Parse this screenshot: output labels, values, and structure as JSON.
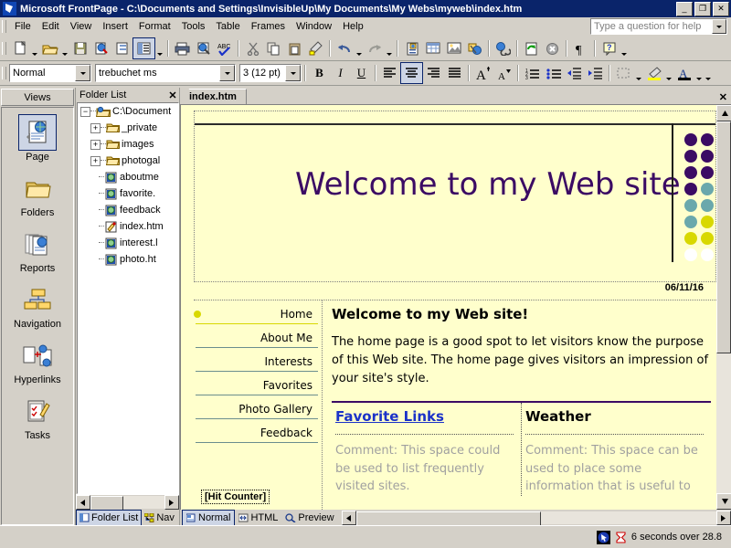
{
  "window": {
    "title": "Microsoft FrontPage - C:\\Documents and Settings\\InvisibleUp\\My Documents\\My Webs\\myweb\\index.htm",
    "minimize": "_",
    "restore": "❐",
    "close": "✕"
  },
  "menu": {
    "items": [
      "File",
      "Edit",
      "View",
      "Insert",
      "Format",
      "Tools",
      "Table",
      "Frames",
      "Window",
      "Help"
    ],
    "help_placeholder": "Type a question for help"
  },
  "standard_toolbar": {
    "buttons": [
      {
        "name": "new-page-icon",
        "title": "New"
      },
      {
        "name": "open-icon",
        "title": "Open"
      },
      {
        "name": "save-icon",
        "title": "Save"
      },
      {
        "name": "publish-web-icon",
        "title": "Publish Web"
      },
      {
        "name": "folder-list-toggle-icon",
        "title": "Toggle Folder List"
      },
      {
        "name": "navigation-pane-icon",
        "title": "Navigation Pane"
      },
      {
        "name": "print-icon",
        "title": "Print"
      },
      {
        "name": "preview-browser-icon",
        "title": "Preview in Browser"
      },
      {
        "name": "spelling-icon",
        "title": "Spelling"
      },
      {
        "name": "cut-icon",
        "title": "Cut"
      },
      {
        "name": "copy-icon",
        "title": "Copy"
      },
      {
        "name": "paste-icon",
        "title": "Paste"
      },
      {
        "name": "format-painter-icon",
        "title": "Format Painter"
      },
      {
        "name": "undo-icon",
        "title": "Undo"
      },
      {
        "name": "redo-icon",
        "title": "Redo"
      },
      {
        "name": "insert-component-icon",
        "title": "Insert Component"
      },
      {
        "name": "insert-table-icon",
        "title": "Insert Table"
      },
      {
        "name": "insert-picture-icon",
        "title": "Insert Picture"
      },
      {
        "name": "drawing-icon",
        "title": "Drawing"
      },
      {
        "name": "hyperlink-icon",
        "title": "Hyperlink"
      },
      {
        "name": "refresh-icon",
        "title": "Refresh"
      },
      {
        "name": "stop-icon",
        "title": "Stop"
      },
      {
        "name": "show-all-icon",
        "title": "Show All"
      },
      {
        "name": "help-icon",
        "title": "Microsoft FrontPage Help"
      }
    ]
  },
  "format_toolbar": {
    "style": "Normal",
    "font": "trebuchet ms",
    "size": "3  (12 pt)",
    "bold": "B",
    "italic": "I",
    "underline": "U",
    "buttons": [
      {
        "name": "align-left-icon"
      },
      {
        "name": "align-center-icon"
      },
      {
        "name": "align-right-icon"
      },
      {
        "name": "justify-icon"
      },
      {
        "name": "increase-font-size-icon"
      },
      {
        "name": "decrease-font-size-icon"
      },
      {
        "name": "numbered-list-icon"
      },
      {
        "name": "bulleted-list-icon"
      },
      {
        "name": "decrease-indent-icon"
      },
      {
        "name": "increase-indent-icon"
      },
      {
        "name": "borders-icon"
      },
      {
        "name": "highlight-color-icon"
      },
      {
        "name": "font-color-icon"
      }
    ]
  },
  "views": {
    "header": "Views",
    "items": [
      {
        "label": "Page",
        "icon": "page-view-icon",
        "selected": true
      },
      {
        "label": "Folders",
        "icon": "folders-view-icon",
        "selected": false
      },
      {
        "label": "Reports",
        "icon": "reports-view-icon",
        "selected": false
      },
      {
        "label": "Navigation",
        "icon": "navigation-view-icon",
        "selected": false
      },
      {
        "label": "Hyperlinks",
        "icon": "hyperlinks-view-icon",
        "selected": false
      },
      {
        "label": "Tasks",
        "icon": "tasks-view-icon",
        "selected": false
      }
    ]
  },
  "folder_list": {
    "header": "Folder List",
    "close": "✕",
    "root": "C:\\Document",
    "nodes": [
      {
        "label": "_private",
        "type": "folder",
        "expander": "+"
      },
      {
        "label": "images",
        "type": "folder",
        "expander": "+"
      },
      {
        "label": "photogal",
        "type": "folder",
        "expander": "+"
      },
      {
        "label": "aboutme",
        "type": "page"
      },
      {
        "label": "favorite.",
        "type": "page"
      },
      {
        "label": "feedback",
        "type": "page"
      },
      {
        "label": "index.htm",
        "type": "page-open"
      },
      {
        "label": "interest.l",
        "type": "page"
      },
      {
        "label": "photo.ht",
        "type": "page"
      }
    ],
    "tabs": [
      {
        "label": "Folder List",
        "icon": "folder-list-icon",
        "selected": true
      },
      {
        "label": "Nav",
        "icon": "navigation-icon",
        "selected": false
      }
    ]
  },
  "document": {
    "tab": "index.htm",
    "close": "✕",
    "view_tabs": [
      {
        "label": "Normal",
        "icon": "normal-view-icon",
        "selected": true
      },
      {
        "label": "HTML",
        "icon": "html-view-icon",
        "selected": false
      },
      {
        "label": "Preview",
        "icon": "preview-view-icon",
        "selected": false
      }
    ]
  },
  "webpage": {
    "banner_title": "Welcome to my Web site",
    "date": "06/11/16",
    "nav_links": [
      {
        "label": "Home",
        "current": true
      },
      {
        "label": "About Me",
        "current": false
      },
      {
        "label": "Interests",
        "current": false
      },
      {
        "label": "Favorites",
        "current": false
      },
      {
        "label": "Photo Gallery",
        "current": false
      },
      {
        "label": "Feedback",
        "current": false
      }
    ],
    "hit_counter": "[Hit Counter]",
    "heading": "Welcome to my Web site!",
    "paragraph": "The home page is a good spot to let visitors know the purpose of this Web site. The home page gives visitors an impression of your site's style.",
    "columns": [
      {
        "title": "Favorite Links",
        "is_link": true,
        "comment": "Comment: This space could be used to list frequently visited sites."
      },
      {
        "title": "Weather",
        "is_link": false,
        "comment": "Comment: This space can be used to place some information that is useful to"
      }
    ],
    "dot_colors": [
      "#3b0b64",
      "#3b0b64",
      "#3b0b64",
      "#ffffff",
      "#ffffff",
      "#3b0b64",
      "#3b0b64",
      "#3b0b64",
      "#6aa8ac",
      "#ffffff",
      "#3b0b64",
      "#3b0b64",
      "#6aa8ac",
      "#6aa8ac",
      "#ffffff",
      "#3b0b64",
      "#6aa8ac",
      "#6aa8ac",
      "#d8d800",
      "#ffffff",
      "#6aa8ac",
      "#6aa8ac",
      "#d8d800",
      "#d8d800",
      "#ffffff",
      "#6aa8ac",
      "#d8d800",
      "#d8d800",
      "#c8c8c8",
      "#ffffff",
      "#d8d800",
      "#d8d800",
      "#c8c8c8",
      "#c8c8c8",
      "#ffffff",
      "#ffffff",
      "#ffffff",
      "#c8c8c8",
      "#c8c8c8",
      "#ffffff"
    ]
  },
  "status": {
    "message": "6 seconds over 28.8",
    "cursor_icon": "pointer-icon",
    "timer_icon": "hourglass-icon"
  },
  "colors": {
    "titlebar": "#0a246a",
    "chrome": "#d4d0c8",
    "page_bg": "#ffffcc",
    "accent_purple": "#3b0b64",
    "accent_teal": "#6aa8ac",
    "accent_yellow": "#d8d800",
    "link_blue": "#1b32c8"
  }
}
